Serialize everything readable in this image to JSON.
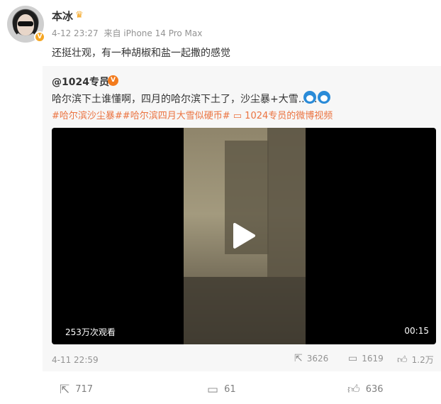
{
  "post": {
    "username": "本冰",
    "timestamp": "4-12 23:27",
    "source": "来自 iPhone 14 Pro Max",
    "text": "还挺壮观，有一种胡椒和盐一起撒的感觉"
  },
  "repost": {
    "username": "@1024专员",
    "text": "哈尔滨下土谁懂啊，四月的哈尔滨下土了，沙尘暴+大雪......",
    "tags": [
      "#哈尔滨沙尘暴#",
      "#哈尔滨四月大雪似硬币#"
    ],
    "video_link": "1024专员的微博视频",
    "video": {
      "views": "253万次观看",
      "duration": "00:15"
    },
    "date": "4-11 22:59",
    "shares": "3626",
    "comments": "1619",
    "likes": "1.2万"
  },
  "footer": {
    "shares": "717",
    "comments": "61",
    "likes": "636"
  },
  "colors": {
    "tag": "#eb7340",
    "muted": "#939393",
    "vip_badge": "#f5a623"
  },
  "icons": [
    "crown-icon",
    "verified-icon",
    "doraemon-emoji-icon",
    "video-link-icon",
    "play-icon",
    "share-icon",
    "comment-icon",
    "like-icon"
  ]
}
